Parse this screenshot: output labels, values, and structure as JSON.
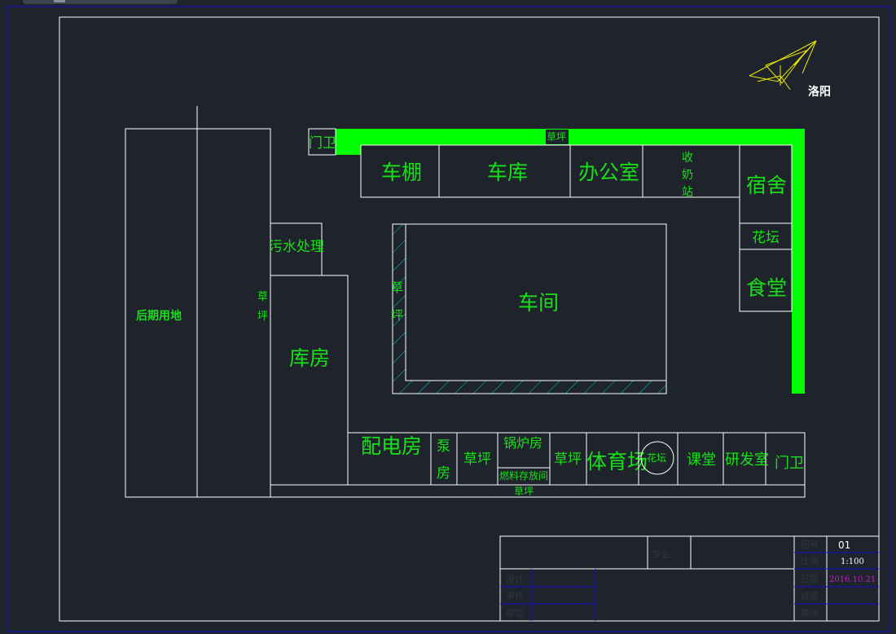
{
  "drawing": {
    "north_label": "洛阳",
    "rooms": {
      "gate_left": "门卫",
      "lawn_top": "草坪",
      "bike_shed": "车棚",
      "garage": "车库",
      "office": "办公室",
      "milk_station": [
        "收",
        "奶",
        "站"
      ],
      "dormitory": "宿舍",
      "flower_bed_right": "花坛",
      "canteen": "食堂",
      "sewage": "污水处理",
      "future_land": "后期用地",
      "lawn_left": [
        "草",
        "坪"
      ],
      "warehouse": "库房",
      "workshop": "车间",
      "lawn_workshop": [
        "草",
        "坪"
      ],
      "power_room": "配电房",
      "pump_room": [
        "泵",
        "房"
      ],
      "lawn_bottom_1": "草坪",
      "boiler_room": "锅炉房",
      "fuel_storage": "燃料存放间",
      "lawn_bottom_2": "草坪",
      "gym": "体育场",
      "flower_bed_circle": "花坛",
      "classroom": "课堂",
      "rnd": "研发室",
      "gate_right": "门卫",
      "lawn_bottom_strip": "草坪"
    }
  },
  "title_block": {
    "major_label": "专业",
    "drawing_no_label": "图号",
    "drawing_no": "01",
    "scale_label": "比例",
    "scale": "1:100",
    "date_label": "日期",
    "date": "2016.10.21",
    "designer_label": "设计",
    "checker_label": "审核",
    "approver_label": "审定",
    "grade_label": "成绩",
    "reviewer_label": "审阅"
  },
  "colors": {
    "background": "#1f242c",
    "text": "#18e018",
    "lawn_fill": "#00ff00",
    "outline": "#ffffff",
    "border": "#1010c8",
    "date": "#c020c0",
    "hatch": "#00c8d0"
  }
}
